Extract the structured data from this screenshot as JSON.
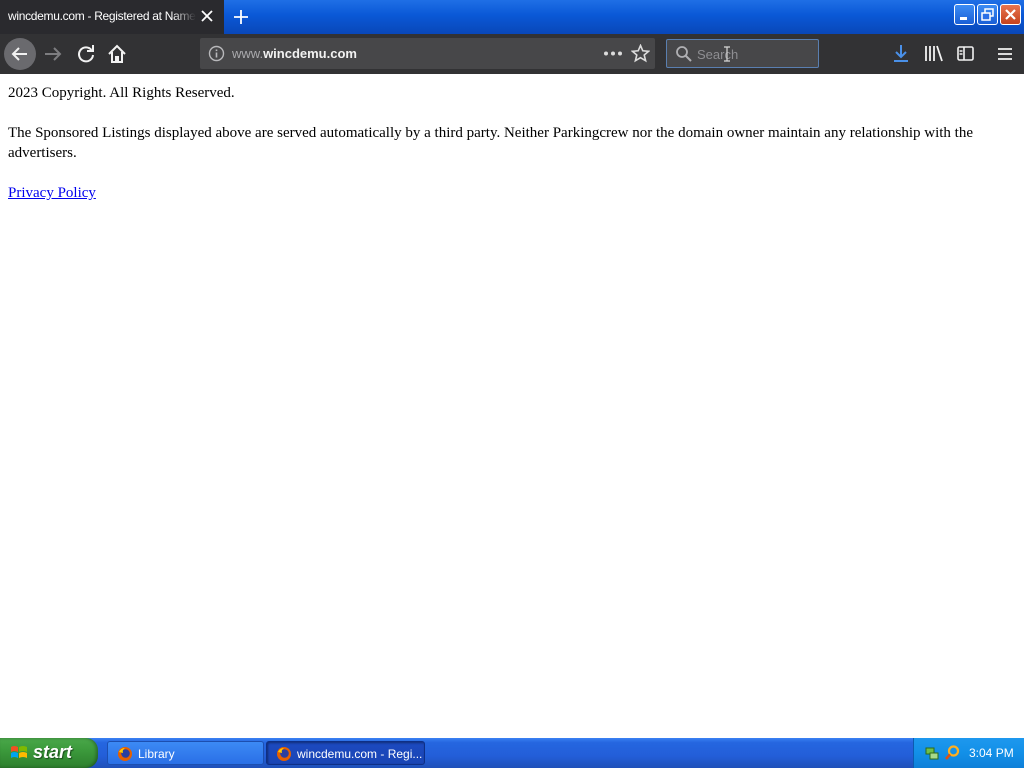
{
  "window": {
    "tab_title": "wincdemu.com - Registered at Namecheap.com"
  },
  "toolbar": {
    "url_prefix": "www.",
    "url_domain": "wincdemu.com",
    "search_placeholder": "Search"
  },
  "page": {
    "copyright": "2023 Copyright. All Rights Reserved.",
    "sponsored_text": "The Sponsored Listings displayed above are served automatically by a third party. Neither Parkingcrew nor the domain owner maintain any relationship with the advertisers.",
    "privacy_link": "Privacy Policy"
  },
  "taskbar": {
    "start_label": "start",
    "items": [
      {
        "label": "Library",
        "icon": "firefox-icon"
      },
      {
        "label": "wincdemu.com - Regi...",
        "icon": "firefox-icon"
      }
    ],
    "clock": "3:04 PM"
  },
  "colors": {
    "toolbar_bg": "#323234",
    "link": "#0000ee",
    "xp_blue": "#235ed8",
    "start_green": "#3c9a3c"
  }
}
